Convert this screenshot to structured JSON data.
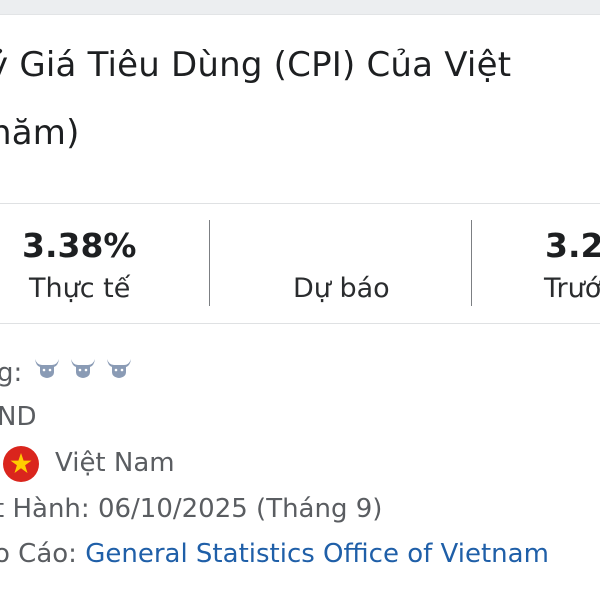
{
  "title": {
    "line1": "ỷ Giá Tiêu Dùng (CPI) Của Việt",
    "line2": "năm)"
  },
  "stats": {
    "actual_value": "3.38%",
    "actual_label": "Thực tế",
    "forecast_value": "",
    "forecast_label": "Dự báo",
    "previous_value": "3.2",
    "previous_label": "Trướ"
  },
  "info": {
    "importance_label": "g:",
    "importance_icon": "bull-icon",
    "importance_count": 3,
    "currency": "ND",
    "country_flag_icon": "vietnam-flag-icon",
    "country": "Việt Nam",
    "release_label": "t Hành:",
    "release_value": "06/10/2025 (Tháng 9)",
    "source_label": "o Cáo:",
    "source_value": "General Statistics Office of Vietnam"
  },
  "colors": {
    "link": "#1f5fa8",
    "muted_text": "#5a5d61",
    "bull_icon": "#8a9bb5",
    "flag_red": "#da251d",
    "flag_star": "#ffcd00"
  }
}
